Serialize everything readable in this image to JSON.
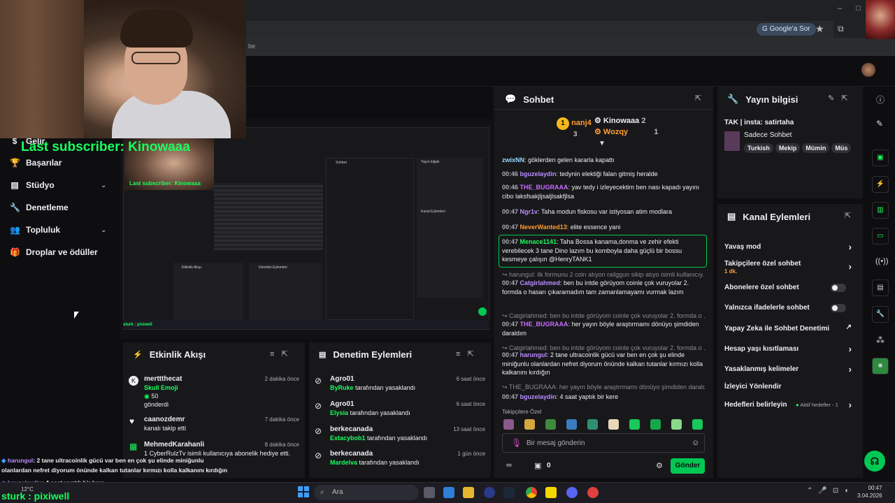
{
  "browser": {
    "google_chip": "Google'a Sor",
    "addr_suffix": "be"
  },
  "overlay": {
    "last_subscriber": "Last subscriber: Kinowaaa",
    "nested_last_subscriber": "Last subscriber: Kinowaaa",
    "bottom_lines": [
      {
        "user": "harungul",
        "text": ": 2 tane ultracoinlik gücü var ben en çok şu elinde miniğunlu"
      },
      {
        "user": "",
        "text": "olanlardan nefret diyorum önünde kalkan tutanlar kırmızı kolla kalkanını kırdığın"
      },
      {
        "user": "bguzelaydin",
        "text": ": 4 saat yaptık bir kere"
      }
    ],
    "streamer_text": "sturk : pixiwell",
    "nested_streamer_text": "sturk : pixiwell"
  },
  "sidebar": {
    "items": [
      {
        "label": "Gelir",
        "icon": "dollar-icon"
      },
      {
        "label": "Başarılar",
        "icon": "trophy-icon"
      },
      {
        "label": "Stüdyo",
        "icon": "studio-icon",
        "expand": true
      },
      {
        "label": "Denetleme",
        "icon": "wrench-icon"
      },
      {
        "label": "Topluluk",
        "icon": "community-icon",
        "expand": true
      },
      {
        "label": "Droplar ve ödüller",
        "icon": "gift-icon"
      }
    ]
  },
  "chat": {
    "title": "Sohbet",
    "top_chatters": [
      {
        "rank": "1",
        "name": "nanj4",
        "count": "3"
      },
      {
        "name": "Kinowaaa",
        "count": "2"
      },
      {
        "name": "Wozqy",
        "count": "1"
      }
    ],
    "messages": [
      {
        "time": "",
        "user": "zwixNN",
        "text": ": göklerden gelen kararla kapattı",
        "color": "#9ad8ff"
      },
      {
        "time": "00:46",
        "user": "bguzelaydin",
        "text": ": tedynin elektiği falan gitmiş heralde",
        "color": "#b98cff"
      },
      {
        "time": "00:46",
        "user": "THE_BUGRAAA",
        "text": ": yav tedy i izleyecektim ben nası kapadı yayını cibo laksfsakjljsaljlsakfjlsa",
        "color": "#c96bff"
      },
      {
        "time": "00:47",
        "user": "Ngr1v",
        "text": ": Taha modun fiskosu var istiyosan atim modlara",
        "color": "#b98cff"
      },
      {
        "time": "00:47",
        "user": "NeverWanted13",
        "text": ": elite essence yani",
        "color": "#ff9d2e"
      },
      {
        "time": "00:47",
        "user": "Menace1141",
        "text": ": Taha Bossa kanama,donma ve zehir efekti verebilecek 3 tane Dino lazım bu komboyla daha güçlü bir bossu kesmeye çalışın @HenryTANK1",
        "color": "#19ff5e"
      },
      {
        "time": "",
        "user": "",
        "text": "↪ harungul: ilk formunu 2 coin atıyon railggun sikip atıyo isimli kullanıcıy...",
        "color": ""
      },
      {
        "time": "00:47",
        "user": "Catgirlahmed",
        "text": ": ben bu intde görüyom coinle çok vuruyolar 2. formda o hasarı çıkaramadım tam zamanlamayamı vurmak lazım",
        "color": "#b98cff"
      },
      {
        "time": "",
        "user": "",
        "text": "↪ Catgirlahmed: ben bu intde görüyom coinle çok vuruyolar 2. formda o ...",
        "color": ""
      },
      {
        "time": "00:47",
        "user": "THE_BUGRAAA",
        "text": ": her yayın böyle araştırmamı dönüyo şimdiden daraldım",
        "color": "#c96bff"
      },
      {
        "time": "",
        "user": "",
        "text": "↪ Catgirlahmed: ben bu intde görüyom coinle çok vuruyolar 2. formda o ...",
        "color": ""
      },
      {
        "time": "00:47",
        "user": "harungul",
        "text": ": 2 tane ultracoinlik gücü var ben en çok şu elinde miniğunlu olanlardan nefret diyorum önünde kalkan tutanlar kırmızı kolla kalkanını kırdığın",
        "color": "#b98cff"
      },
      {
        "time": "",
        "user": "",
        "text": "↪ THE_BUGRAAA: her yayın böyle araştırmamı dönüyo şimdiden daraldı...",
        "color": ""
      },
      {
        "time": "00:47",
        "user": "bguzelaydin",
        "text": ": 4 saat yaptık bir kere",
        "color": "#b98cff"
      }
    ],
    "emote_section": "Takipçilere Özel",
    "input_placeholder": "Bir mesaj gönderin",
    "points": "0",
    "send_label": "Gönder"
  },
  "stream_info": {
    "title": "Yayın bilgisi",
    "stream_title": "TAK | insta: satirtaha",
    "category": "Sadece Sohbet",
    "tags": [
      "Turkish",
      "Mekip",
      "Mümin",
      "Müs"
    ]
  },
  "channel_actions": {
    "title": "Kanal Eylemleri",
    "items": [
      {
        "label": "Yavaş mod",
        "type": "arrow"
      },
      {
        "label": "Takipçilere özel sohbet",
        "sub": "1 dk.",
        "type": "arrow"
      },
      {
        "label": "Abonelere özel sohbet",
        "type": "toggle"
      },
      {
        "label": "Yalnızca ifadelerle sohbet",
        "type": "toggle"
      },
      {
        "label": "Yapay Zeka ile Sohbet Denetimi",
        "type": "external"
      },
      {
        "label": "Hesap yaşı kısıtlaması",
        "type": "arrow"
      },
      {
        "label": "Yasaklanmış kelimeler",
        "type": "arrow"
      },
      {
        "label": "İzleyici Yönlendir",
        "type": "none"
      },
      {
        "label": "Hedefleri belirleyin",
        "status": "Aktif hedefler - 1",
        "type": "arrow"
      }
    ]
  },
  "activity_feed": {
    "title": "Etkinlik Akışı",
    "items": [
      {
        "user": "merttthecat",
        "detail": "Skull Emoji",
        "amount": "50",
        "action": "gönderdi",
        "time": "2 dakika önce"
      },
      {
        "user": "caanozdemr",
        "action": "kanalı takip etti",
        "time": "7 dakika önce"
      },
      {
        "user": "MehmedKarahanli",
        "action": "1 CyberRulzTv isimli kullanıcıya abonelik hediye etti.",
        "time": "8 dakika önce"
      }
    ]
  },
  "mod_actions": {
    "title": "Denetim Eylemleri",
    "items": [
      {
        "target": "Agro01",
        "mod": "ByRuke",
        "action": "tarafından yasaklandı",
        "time": "6 saat önce"
      },
      {
        "target": "Agro01",
        "mod": "Elysia",
        "action": "tarafından yasaklandı",
        "time": "6 saat önce"
      },
      {
        "target": "berkecanada",
        "mod": "Extacybob1",
        "action": "tarafından yasaklandı",
        "time": "13 saat önce"
      },
      {
        "target": "berkecanada",
        "mod": "Mardelva",
        "action": "tarafından yasaklandı",
        "time": "1 gün önce"
      }
    ],
    "extra_time": "8 dakika önce"
  },
  "taskbar": {
    "search": "Ara",
    "time": "00:47",
    "date": "3.04.2026",
    "weather": "12°C"
  },
  "colors": {
    "accent": "#00c853",
    "overlay_green": "#19ff5e",
    "bg": "#0e0e10",
    "panel": "#18181b"
  }
}
